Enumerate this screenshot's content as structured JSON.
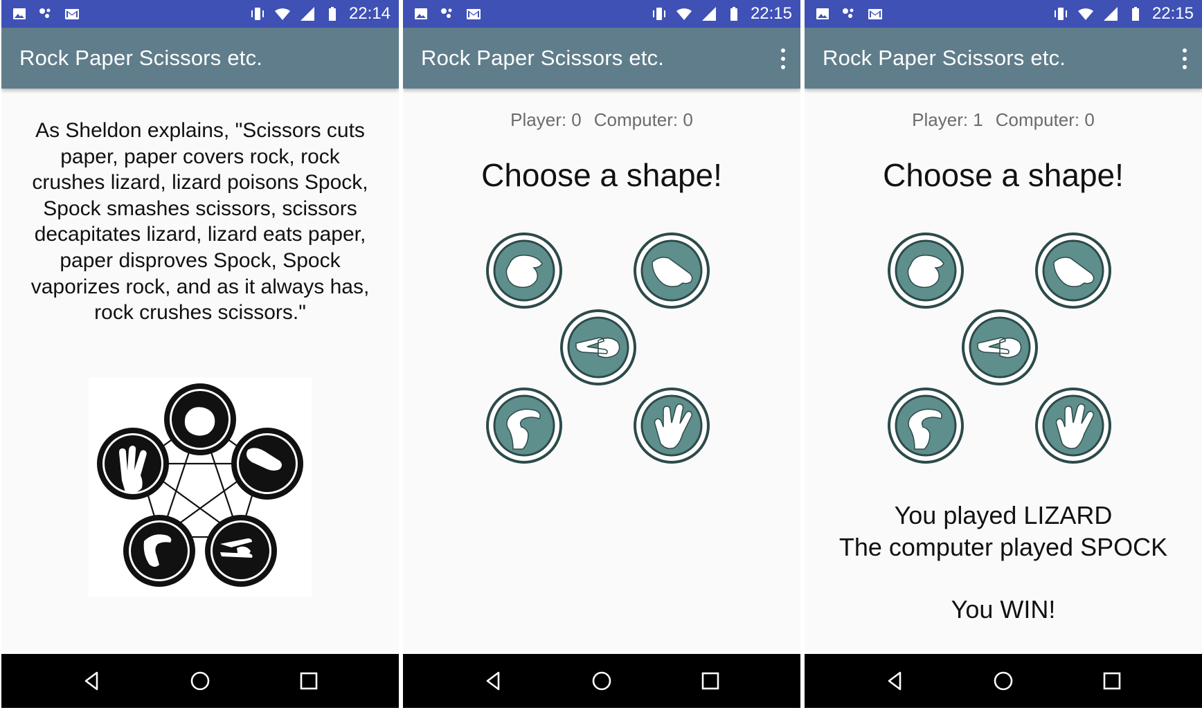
{
  "app": {
    "title": "Rock Paper Scissors etc.",
    "primary_color": "#607d8b",
    "status_bar_color": "#3f51b5",
    "shape_fill_color": "#5f8f8c"
  },
  "screens": [
    {
      "clock": "22:14",
      "intro": "As Sheldon explains, \"Scissors cuts paper, paper covers rock, rock crushes lizard, lizard poisons Spock, Spock smashes scissors, scissors decapitates lizard, lizard eats paper, paper disproves Spock, Spock vaporizes rock, and as it always has, rock crushes scissors.\"",
      "diagram_icon": "rock-paper-scissors-lizard-spock-diagram"
    },
    {
      "clock": "22:15",
      "score_player": "Player: 0",
      "score_computer": "Computer: 0",
      "prompt": "Choose a shape!"
    },
    {
      "clock": "22:15",
      "score_player": "Player: 1",
      "score_computer": "Computer: 0",
      "prompt": "Choose a shape!",
      "result_line1": "You played LIZARD",
      "result_line2": "The computer played SPOCK",
      "result_outcome": "You WIN!"
    }
  ],
  "shapes": [
    "rock",
    "paper",
    "scissors",
    "lizard",
    "spock"
  ],
  "status_icons": [
    "image-icon",
    "dots-icon",
    "gmail-icon",
    "vibrate-icon",
    "wifi-icon",
    "signal-icon",
    "battery-icon"
  ],
  "nav_icons": [
    "back-icon",
    "home-icon",
    "recents-icon"
  ]
}
